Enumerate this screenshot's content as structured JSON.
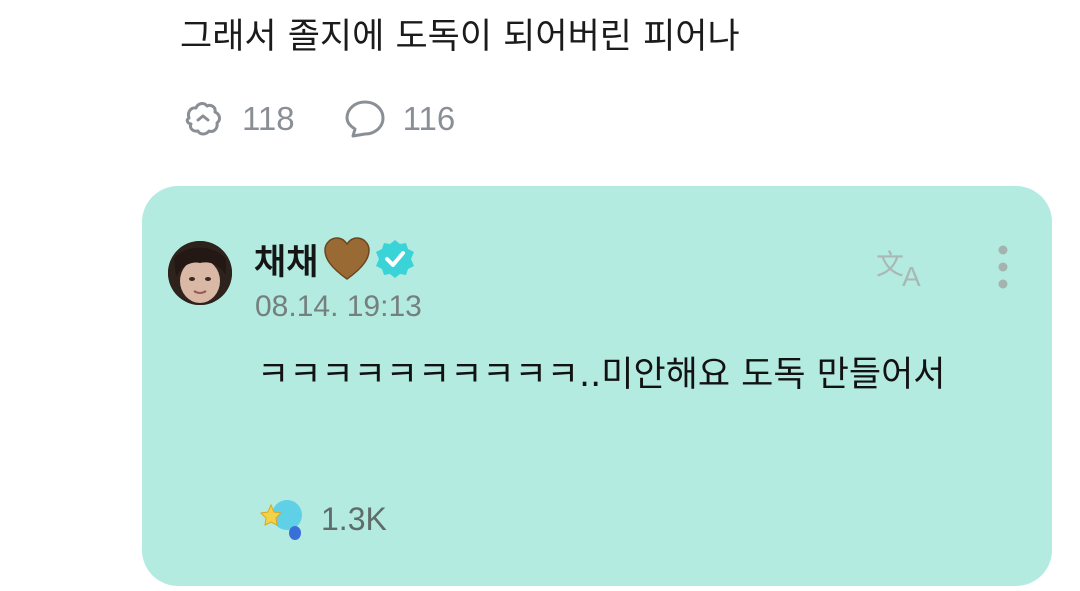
{
  "post": {
    "text": "그래서 졸지에 도독이 되어버린 피어나",
    "likes": "118",
    "comments": "116"
  },
  "comment": {
    "author": "채채",
    "heart_icon": "brown-heart-icon",
    "verified_icon": "verified-badge-icon",
    "timestamp": "08.14. 19:13",
    "body": "ㅋㅋㅋㅋㅋㅋㅋㅋㅋㅋ..미안해요 도독 만들어서",
    "reaction_count": "1.3K",
    "card_color": "#b3ebe1",
    "verified_color": "#39d3d8"
  }
}
